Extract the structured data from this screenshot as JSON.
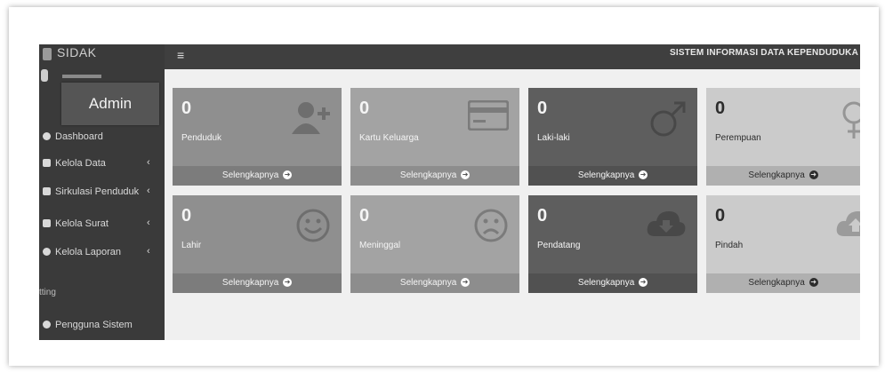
{
  "app": {
    "brand": "SIDAK",
    "system_title": "SISTEM INFORMASI DATA KEPENDUDUKA"
  },
  "user": {
    "name": "Admin"
  },
  "sidebar": {
    "items": [
      {
        "label": "Dashboard",
        "icon": "dashboard-icon",
        "has_submenu": false
      },
      {
        "label": "Kelola Data",
        "icon": "data-icon",
        "has_submenu": true
      },
      {
        "label": "Sirkulasi Penduduk",
        "icon": "share-icon",
        "has_submenu": true
      },
      {
        "label": "Kelola Surat",
        "icon": "document-icon",
        "has_submenu": true
      },
      {
        "label": "Kelola Laporan",
        "icon": "report-icon",
        "has_submenu": true
      }
    ],
    "section_label": "tting",
    "footer_item": {
      "label": "Pengguna Sistem",
      "icon": "user-icon"
    },
    "chevron": "‹"
  },
  "topbar": {
    "menu_icon": "≡"
  },
  "stats": {
    "more_label": "Selengkapnya",
    "boxes": [
      {
        "value": "0",
        "label": "Penduduk",
        "icon": "user-plus-icon",
        "color": "#8f8f8f",
        "light": false
      },
      {
        "value": "0",
        "label": "Kartu Keluarga",
        "icon": "credit-card-icon",
        "color": "#a3a3a3",
        "light": false
      },
      {
        "value": "0",
        "label": "Laki-laki",
        "icon": "male-icon",
        "color": "#5e5e5e",
        "light": false
      },
      {
        "value": "0",
        "label": "Perempuan",
        "icon": "female-icon",
        "color": "#cbcbcb",
        "light": true
      },
      {
        "value": "0",
        "label": "Lahir",
        "icon": "smile-icon",
        "color": "#8f8f8f",
        "light": false
      },
      {
        "value": "0",
        "label": "Meninggal",
        "icon": "frown-icon",
        "color": "#a3a3a3",
        "light": false
      },
      {
        "value": "0",
        "label": "Pendatang",
        "icon": "cloud-download-icon",
        "color": "#5e5e5e",
        "light": false
      },
      {
        "value": "0",
        "label": "Pindah",
        "icon": "cloud-upload-icon",
        "color": "#cbcbcb",
        "light": true
      }
    ]
  }
}
